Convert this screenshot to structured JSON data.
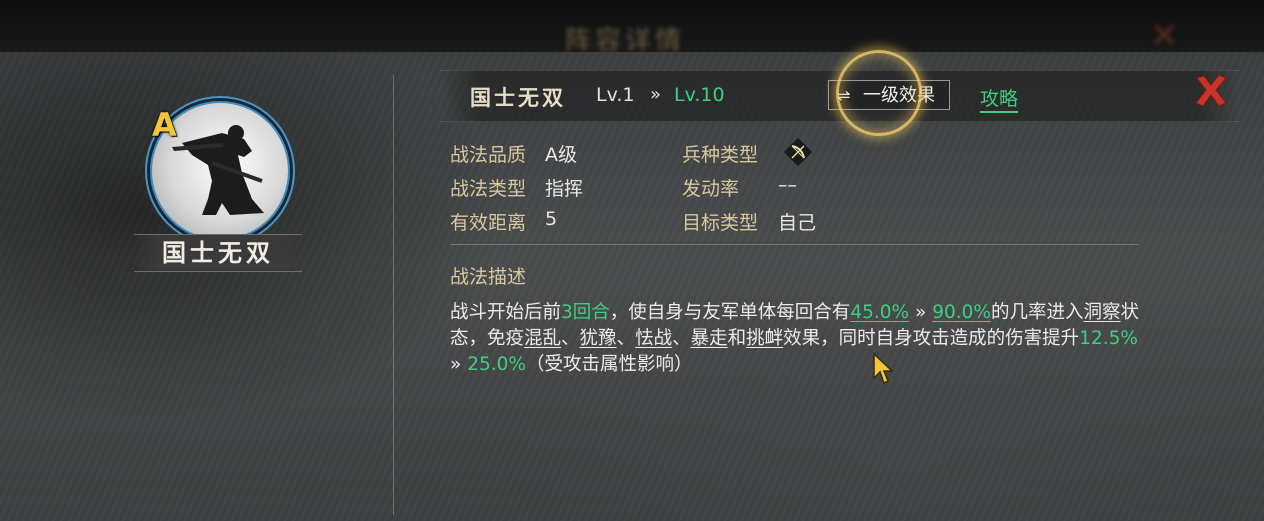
{
  "background": {
    "top_title": "阵容详情"
  },
  "skill": {
    "grade": "A",
    "name": "国士无双",
    "title": "国士无双",
    "level_from": "Lv.1",
    "level_arrow": "»",
    "level_to": "Lv.10"
  },
  "header": {
    "effect_button": {
      "icon": "swap-icon",
      "label": "一级效果"
    },
    "guide_link": "攻略",
    "close_icon": "close-icon"
  },
  "attributes": {
    "quality": {
      "label": "战法品质",
      "value": "A级"
    },
    "troop_type": {
      "label": "兵种类型",
      "icon": "bow-icon"
    },
    "skill_type": {
      "label": "战法类型",
      "value": "指挥"
    },
    "trigger_rate": {
      "label": "发动率",
      "value": "––"
    },
    "range": {
      "label": "有效距离",
      "value": "5"
    },
    "target": {
      "label": "目标类型",
      "value": "自己"
    }
  },
  "description": {
    "title": "战法描述",
    "segments": {
      "s1": "战斗开始后前",
      "s2": "3回合",
      "s3": "，使自身与友军单体每回合有",
      "s4": "45.0%",
      "s5": " » ",
      "s6": "90.0%",
      "s7": "的几率进入",
      "s8": "洞察",
      "s9": "状态，免疫",
      "s10": "混乱",
      "s11": "、",
      "s12": "犹豫",
      "s13": "、",
      "s14": "怯战",
      "s15": "、",
      "s16": "暴走",
      "s17": "和",
      "s18": "挑衅",
      "s19": "效果，同时自身攻击造成的伤害提升",
      "s20": "12.5%",
      "s21": " » ",
      "s22": "25.0%",
      "s23": "（受攻击属性影响）"
    }
  },
  "colors": {
    "accent_green": "#3fcf7f",
    "label_gold": "#d9c89f",
    "grade_gold": "#f2c53d",
    "close_red": "#c8342b",
    "ring_blue": "#3a8bc3"
  }
}
